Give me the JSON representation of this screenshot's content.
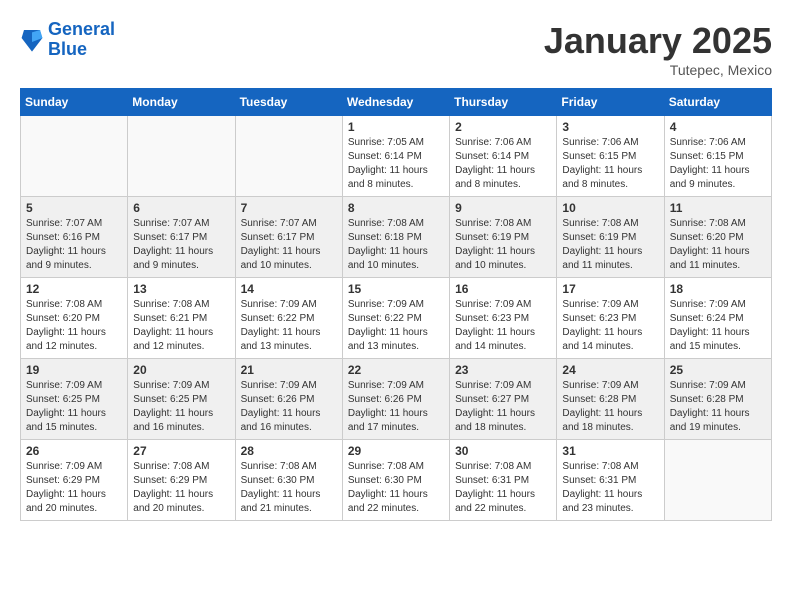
{
  "logo": {
    "line1": "General",
    "line2": "Blue"
  },
  "header": {
    "month": "January 2025",
    "location": "Tutepec, Mexico"
  },
  "weekdays": [
    "Sunday",
    "Monday",
    "Tuesday",
    "Wednesday",
    "Thursday",
    "Friday",
    "Saturday"
  ],
  "weeks": [
    [
      {
        "day": "",
        "info": ""
      },
      {
        "day": "",
        "info": ""
      },
      {
        "day": "",
        "info": ""
      },
      {
        "day": "1",
        "info": "Sunrise: 7:05 AM\nSunset: 6:14 PM\nDaylight: 11 hours\nand 8 minutes."
      },
      {
        "day": "2",
        "info": "Sunrise: 7:06 AM\nSunset: 6:14 PM\nDaylight: 11 hours\nand 8 minutes."
      },
      {
        "day": "3",
        "info": "Sunrise: 7:06 AM\nSunset: 6:15 PM\nDaylight: 11 hours\nand 8 minutes."
      },
      {
        "day": "4",
        "info": "Sunrise: 7:06 AM\nSunset: 6:15 PM\nDaylight: 11 hours\nand 9 minutes."
      }
    ],
    [
      {
        "day": "5",
        "info": "Sunrise: 7:07 AM\nSunset: 6:16 PM\nDaylight: 11 hours\nand 9 minutes."
      },
      {
        "day": "6",
        "info": "Sunrise: 7:07 AM\nSunset: 6:17 PM\nDaylight: 11 hours\nand 9 minutes."
      },
      {
        "day": "7",
        "info": "Sunrise: 7:07 AM\nSunset: 6:17 PM\nDaylight: 11 hours\nand 10 minutes."
      },
      {
        "day": "8",
        "info": "Sunrise: 7:08 AM\nSunset: 6:18 PM\nDaylight: 11 hours\nand 10 minutes."
      },
      {
        "day": "9",
        "info": "Sunrise: 7:08 AM\nSunset: 6:19 PM\nDaylight: 11 hours\nand 10 minutes."
      },
      {
        "day": "10",
        "info": "Sunrise: 7:08 AM\nSunset: 6:19 PM\nDaylight: 11 hours\nand 11 minutes."
      },
      {
        "day": "11",
        "info": "Sunrise: 7:08 AM\nSunset: 6:20 PM\nDaylight: 11 hours\nand 11 minutes."
      }
    ],
    [
      {
        "day": "12",
        "info": "Sunrise: 7:08 AM\nSunset: 6:20 PM\nDaylight: 11 hours\nand 12 minutes."
      },
      {
        "day": "13",
        "info": "Sunrise: 7:08 AM\nSunset: 6:21 PM\nDaylight: 11 hours\nand 12 minutes."
      },
      {
        "day": "14",
        "info": "Sunrise: 7:09 AM\nSunset: 6:22 PM\nDaylight: 11 hours\nand 13 minutes."
      },
      {
        "day": "15",
        "info": "Sunrise: 7:09 AM\nSunset: 6:22 PM\nDaylight: 11 hours\nand 13 minutes."
      },
      {
        "day": "16",
        "info": "Sunrise: 7:09 AM\nSunset: 6:23 PM\nDaylight: 11 hours\nand 14 minutes."
      },
      {
        "day": "17",
        "info": "Sunrise: 7:09 AM\nSunset: 6:23 PM\nDaylight: 11 hours\nand 14 minutes."
      },
      {
        "day": "18",
        "info": "Sunrise: 7:09 AM\nSunset: 6:24 PM\nDaylight: 11 hours\nand 15 minutes."
      }
    ],
    [
      {
        "day": "19",
        "info": "Sunrise: 7:09 AM\nSunset: 6:25 PM\nDaylight: 11 hours\nand 15 minutes."
      },
      {
        "day": "20",
        "info": "Sunrise: 7:09 AM\nSunset: 6:25 PM\nDaylight: 11 hours\nand 16 minutes."
      },
      {
        "day": "21",
        "info": "Sunrise: 7:09 AM\nSunset: 6:26 PM\nDaylight: 11 hours\nand 16 minutes."
      },
      {
        "day": "22",
        "info": "Sunrise: 7:09 AM\nSunset: 6:26 PM\nDaylight: 11 hours\nand 17 minutes."
      },
      {
        "day": "23",
        "info": "Sunrise: 7:09 AM\nSunset: 6:27 PM\nDaylight: 11 hours\nand 18 minutes."
      },
      {
        "day": "24",
        "info": "Sunrise: 7:09 AM\nSunset: 6:28 PM\nDaylight: 11 hours\nand 18 minutes."
      },
      {
        "day": "25",
        "info": "Sunrise: 7:09 AM\nSunset: 6:28 PM\nDaylight: 11 hours\nand 19 minutes."
      }
    ],
    [
      {
        "day": "26",
        "info": "Sunrise: 7:09 AM\nSunset: 6:29 PM\nDaylight: 11 hours\nand 20 minutes."
      },
      {
        "day": "27",
        "info": "Sunrise: 7:08 AM\nSunset: 6:29 PM\nDaylight: 11 hours\nand 20 minutes."
      },
      {
        "day": "28",
        "info": "Sunrise: 7:08 AM\nSunset: 6:30 PM\nDaylight: 11 hours\nand 21 minutes."
      },
      {
        "day": "29",
        "info": "Sunrise: 7:08 AM\nSunset: 6:30 PM\nDaylight: 11 hours\nand 22 minutes."
      },
      {
        "day": "30",
        "info": "Sunrise: 7:08 AM\nSunset: 6:31 PM\nDaylight: 11 hours\nand 22 minutes."
      },
      {
        "day": "31",
        "info": "Sunrise: 7:08 AM\nSunset: 6:31 PM\nDaylight: 11 hours\nand 23 minutes."
      },
      {
        "day": "",
        "info": ""
      }
    ]
  ]
}
